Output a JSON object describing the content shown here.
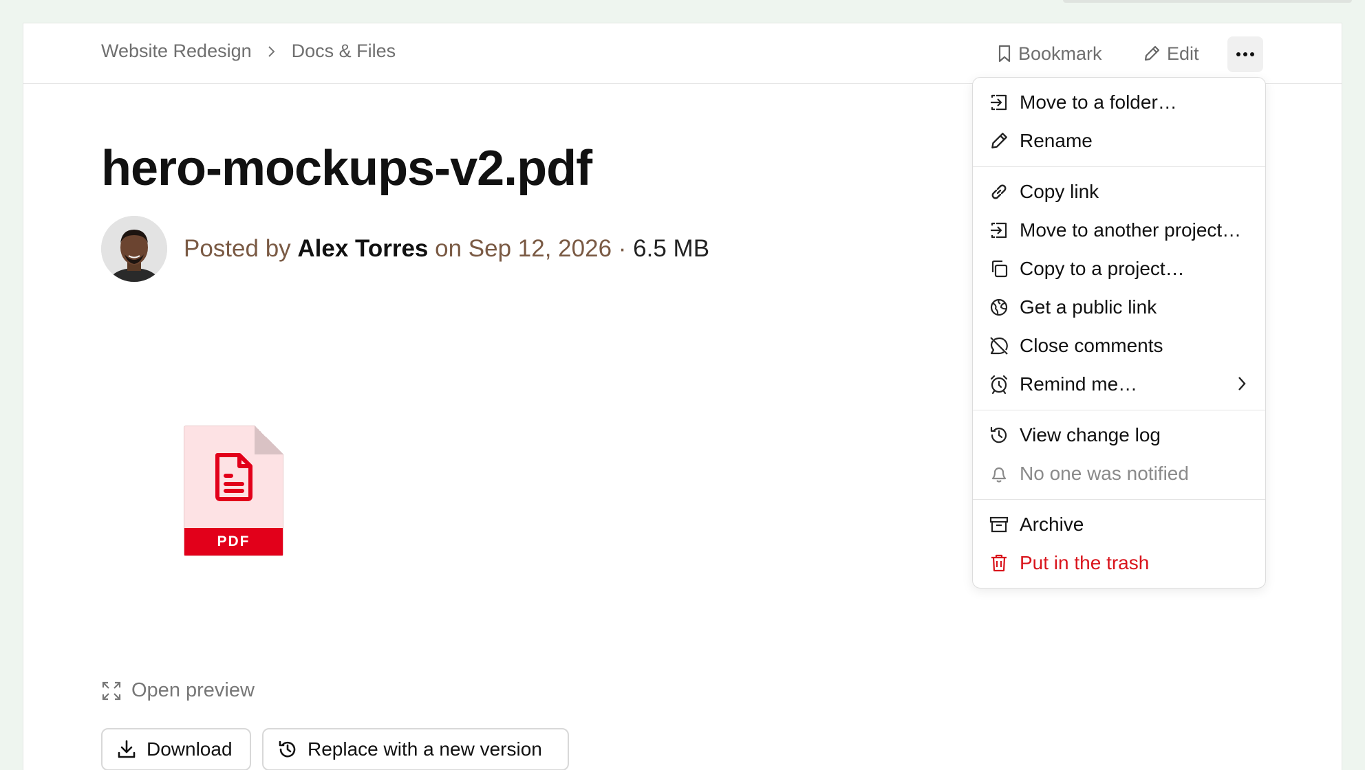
{
  "header": {
    "breadcrumb": [
      {
        "label": "Website Redesign"
      },
      {
        "label": "Docs & Files"
      }
    ],
    "bookmark_label": "Bookmark",
    "edit_label": "Edit",
    "more_label": "More actions"
  },
  "file": {
    "title": "hero-mockups-v2.pdf",
    "posted_by_prefix": "Posted by",
    "author": "Alex Torres",
    "on_prefix": "on",
    "date": "Sep 12, 2026",
    "separator": "·",
    "size": "6.5 MB",
    "type_badge": "PDF"
  },
  "actions": {
    "open_preview": "Open preview",
    "download": "Download",
    "replace": "Replace with a new version"
  },
  "menu": {
    "items": [
      {
        "label": "Move to a folder…",
        "icon": "move-in-icon"
      },
      {
        "label": "Rename",
        "icon": "pencil-icon"
      },
      {
        "label": "Copy link",
        "icon": "link-icon"
      },
      {
        "label": "Move to another project…",
        "icon": "move-in-icon"
      },
      {
        "label": "Copy to a project…",
        "icon": "copy-icon"
      },
      {
        "label": "Get a public link",
        "icon": "globe-icon"
      },
      {
        "label": "Close comments",
        "icon": "comment-off-icon"
      },
      {
        "label": "Remind me…",
        "icon": "alarm-icon"
      },
      {
        "label": "View change log",
        "icon": "history-icon"
      },
      {
        "label": "No one was notified",
        "icon": "bell-icon"
      },
      {
        "label": "Archive",
        "icon": "archive-icon"
      },
      {
        "label": "Put in the trash",
        "icon": "trash-icon"
      }
    ]
  },
  "colors": {
    "danger": "#d9141c",
    "pdf_red": "#e2001a",
    "meta_brown": "#7a5a44"
  }
}
